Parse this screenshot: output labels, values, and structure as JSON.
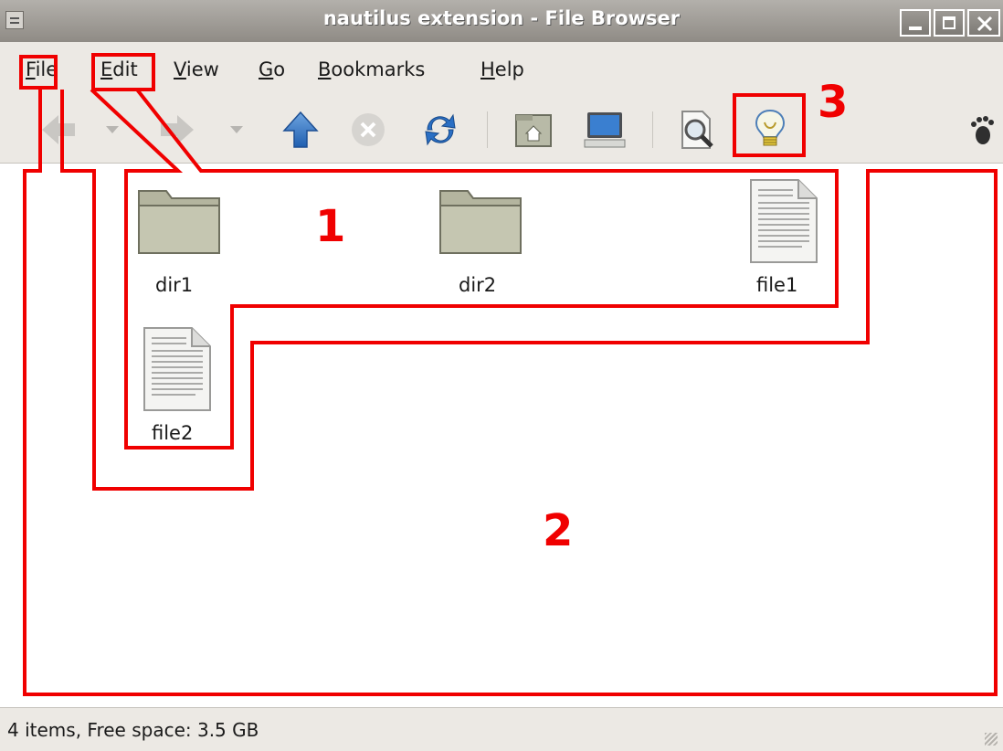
{
  "window": {
    "title": "nautilus extension - File Browser",
    "buttons": [
      "minimize-icon",
      "maximize-icon",
      "close-icon"
    ]
  },
  "menubar": {
    "items": [
      {
        "label": "File",
        "mnemonic": "F",
        "rest": "ile"
      },
      {
        "label": "Edit",
        "mnemonic": "E",
        "rest": "dit"
      },
      {
        "label": "View",
        "mnemonic": "V",
        "rest": "iew"
      },
      {
        "label": "Go",
        "mnemonic": "G",
        "rest": "o"
      },
      {
        "label": "Bookmarks",
        "mnemonic": "B",
        "rest": "ookmarks"
      },
      {
        "label": "Help",
        "mnemonic": "H",
        "rest": "elp"
      }
    ]
  },
  "toolbar": {
    "icons": [
      "back-icon",
      "back-history-chevron-icon",
      "forward-icon",
      "forward-history-chevron-icon",
      "up-arrow-icon",
      "stop-icon",
      "reload-icon",
      "home-folder-icon",
      "computer-icon",
      "search-icon",
      "lightbulb-icon",
      "gnome-foot-icon"
    ]
  },
  "files": [
    {
      "name": "dir1",
      "type": "folder"
    },
    {
      "name": "dir2",
      "type": "folder"
    },
    {
      "name": "file1",
      "type": "file"
    },
    {
      "name": "file2",
      "type": "file"
    }
  ],
  "annotations": {
    "one": "1",
    "two": "2",
    "three": "3",
    "color": "#f00000"
  },
  "status": {
    "text": "4 items, Free space: 3.5 GB"
  }
}
